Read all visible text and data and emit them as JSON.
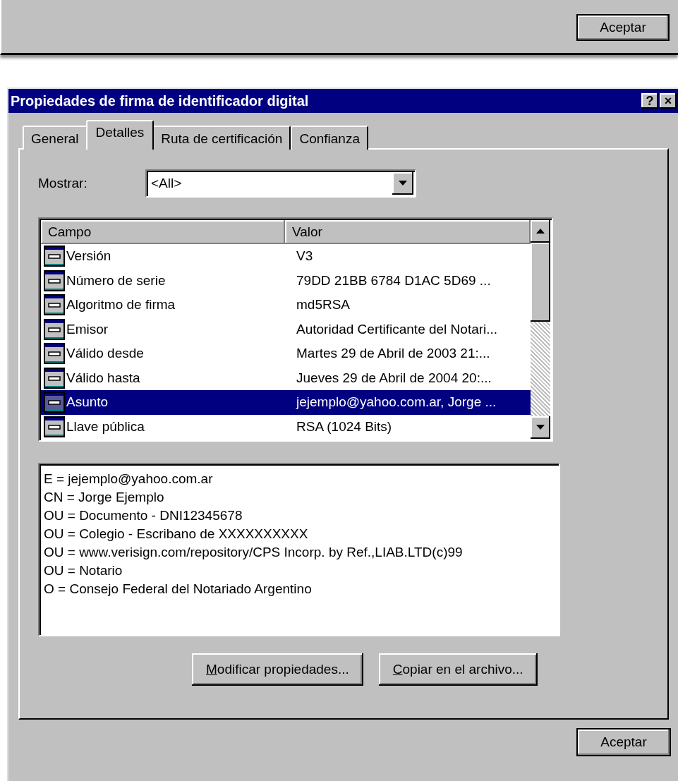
{
  "background_dialog": {
    "ok_button": "Aceptar"
  },
  "window": {
    "title": "Propiedades de firma de identificador digital",
    "title_buttons": [
      "?",
      "×"
    ]
  },
  "tabs": [
    {
      "label": "General",
      "selected": false
    },
    {
      "label": "Detalles",
      "selected": true
    },
    {
      "label": "Ruta de certificación",
      "selected": false
    },
    {
      "label": "Confianza",
      "selected": false
    }
  ],
  "show": {
    "label": "Mostrar:",
    "value": "<All>"
  },
  "table": {
    "columns": [
      "Campo",
      "Valor"
    ],
    "rows": [
      {
        "field": "Versión",
        "value": "V3",
        "selected": false
      },
      {
        "field": "Número de serie",
        "value": "79DD 21BB 6784 D1AC 5D69 ...",
        "selected": false
      },
      {
        "field": "Algoritmo de firma",
        "value": "md5RSA",
        "selected": false
      },
      {
        "field": "Emisor",
        "value": "Autoridad Certificante del Notari...",
        "selected": false
      },
      {
        "field": "Válido desde",
        "value": "Martes 29 de Abril de 2003 21:...",
        "selected": false
      },
      {
        "field": "Válido hasta",
        "value": "Jueves 29 de Abril de 2004 20:...",
        "selected": false
      },
      {
        "field": "Asunto",
        "value": "jejemplo@yahoo.com.ar, Jorge ...",
        "selected": true
      },
      {
        "field": "Llave pública",
        "value": "RSA (1024 Bits)",
        "selected": false
      }
    ]
  },
  "details": [
    "E = jejemplo@yahoo.com.ar",
    "CN = Jorge Ejemplo",
    "OU = Documento - DNI12345678",
    "OU = Colegio - Escribano de XXXXXXXXXX",
    "OU = www.verisign.com/repository/CPS Incorp. by Ref.,LIAB.LTD(c)99",
    "OU = Notario",
    "O = Consejo Federal del Notariado Argentino"
  ],
  "actions": [
    {
      "label": "Modificar propiedades...",
      "underline_first": true
    },
    {
      "label": "Copiar en el archivo...",
      "underline_first": true
    }
  ],
  "ok_button": "Aceptar"
}
